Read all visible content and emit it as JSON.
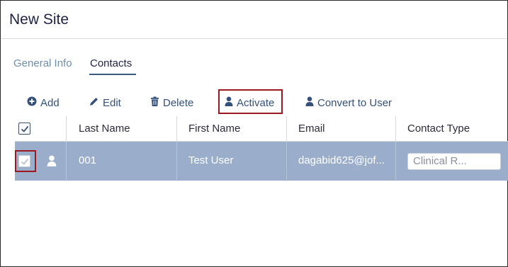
{
  "page": {
    "title": "New Site"
  },
  "tabs": [
    {
      "label": "General Info",
      "active": false
    },
    {
      "label": "Contacts",
      "active": true
    }
  ],
  "toolbar": {
    "add_label": "Add",
    "edit_label": "Edit",
    "delete_label": "Delete",
    "activate_label": "Activate",
    "convert_label": "Convert to User",
    "icons": [
      "plus-circle-icon",
      "pencil-icon",
      "trash-icon",
      "user-icon",
      "user-icon"
    ]
  },
  "table": {
    "columns": [
      "Last Name",
      "First Name",
      "Email",
      "Contact Type"
    ],
    "header_checkbox_checked": true,
    "rows": [
      {
        "selected": true,
        "checked": true,
        "last_name": "001",
        "first_name": "Test User",
        "email": "dagabid625@jof...",
        "contact_type": "Clinical R..."
      }
    ]
  },
  "colors": {
    "title": "#1f2244",
    "tab_inactive": "#6f8eab",
    "toolbar_text": "#35517a",
    "selected_row": "#9aaecb",
    "highlight_border": "#9b1a21"
  }
}
